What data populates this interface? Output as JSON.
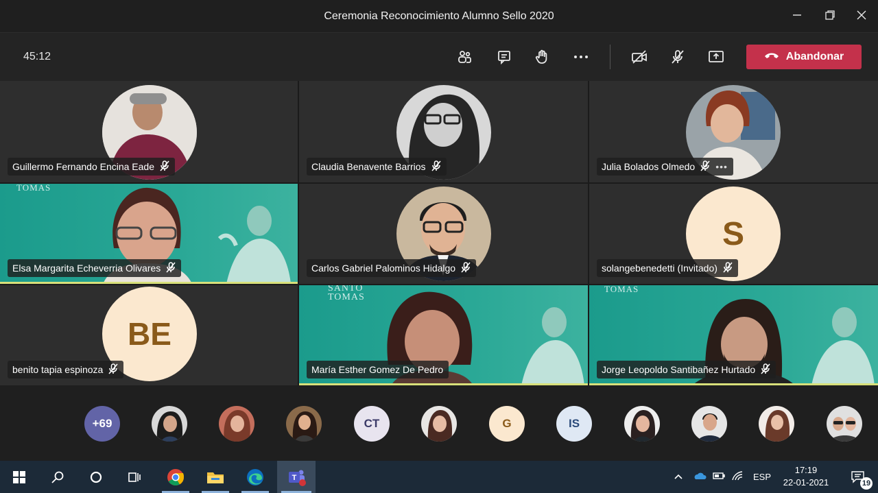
{
  "window": {
    "title": "Ceremonia Reconocimiento Alumno Sello 2020",
    "minimize_icon": "minimize-icon",
    "restore_icon": "restore-icon",
    "close_icon": "close-icon"
  },
  "toolbar": {
    "timer": "45:12",
    "buttons": [
      "participants-icon",
      "chat-icon",
      "raise-hand-icon",
      "more-options-icon",
      "camera-off-icon",
      "mic-off-icon",
      "share-screen-icon"
    ],
    "leave_label": "Abandonar"
  },
  "tiles": [
    {
      "name": "Guillermo Fernando Encina Eade",
      "muted": true
    },
    {
      "name": "Claudia Benavente Barrios",
      "muted": true
    },
    {
      "name": "Julia Bolados Olmedo",
      "muted": true
    },
    {
      "name": "Elsa Margarita Echeverria Olivares",
      "muted": true,
      "brand": "TOMAS"
    },
    {
      "name": "Carlos Gabriel Palominos Hidalgo",
      "muted": true
    },
    {
      "name": "solangebenedetti (Invitado)",
      "muted": true,
      "initials": "S"
    },
    {
      "name": "benito tapia espinoza",
      "muted": true,
      "initials": "BE"
    },
    {
      "name": "María Esther Gomez De Pedro",
      "muted": false,
      "brand": "SANTO TOMAS"
    },
    {
      "name": "Jorge Leopoldo Santibañez Hurtado",
      "muted": true,
      "brand": "TOMAS"
    }
  ],
  "strip": {
    "overflow": "+69",
    "avatars": [
      "photo",
      "photo",
      "photo",
      "CT",
      "photo",
      "G",
      "IS",
      "photo",
      "photo",
      "photo",
      "photo"
    ]
  },
  "taskbar": {
    "apps": [
      "windows-start-icon",
      "search-icon",
      "cortana-icon",
      "task-view-icon",
      "chrome-icon",
      "file-explorer-icon",
      "edge-icon",
      "teams-icon"
    ],
    "language": "ESP",
    "time": "17:19",
    "date": "22-01-2021",
    "notifications": "19"
  },
  "colors": {
    "leave_button": "#c4314b",
    "initials_bg": "#fbe8cf",
    "initials_text": "#8a5a1a",
    "strip_overflow_bg": "#6264a7",
    "teal_background": "#2aa896"
  }
}
